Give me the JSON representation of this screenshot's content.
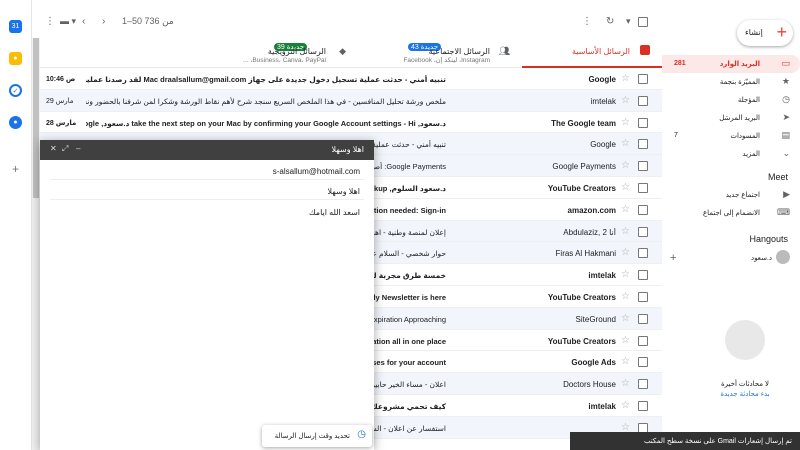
{
  "toolbar": {
    "pagination": "1–50 من 736"
  },
  "tabs": [
    {
      "name": "الرسائل الأساسية",
      "sub": "",
      "badge": ""
    },
    {
      "name": "الرسائل الاجتماعية",
      "sub": "Instagram، لينكد إن، Facebook",
      "badge": "43 جديدة"
    },
    {
      "name": "الرسائل الترويجية",
      "sub": "Business، Canva، PayPal، ...",
      "badge": "39 جديدة"
    }
  ],
  "emails": [
    {
      "sender": "Google",
      "subject": "تنبيه أمني - حدثت عملية تسجيل دخول جديدة على جهاز Mac draalsallum@gmail.com لقد رصدنا عملية تسجيل دخول جديدة إلى حسابك على Google",
      "date": "10:46 ص",
      "unread": true
    },
    {
      "sender": "imtelak",
      "subject": "ملخص ورشة تحليل المنافسين - في هذا الملخص السريع سنجد شرح لأهم نقاط الورشة وشكرا لمن شرفنا بالحضور ونسعد بكم دائما ورشة كله مساعدة وتشارك معنا",
      "date": "29 مارس",
      "unread": false
    },
    {
      "sender": "The Google team",
      "subject": "د.سعود, take the next step on your Mac by confirming your Google Account settings - Hi د.سعود, Welcome to Google",
      "date": "28 مارس",
      "unread": true
    },
    {
      "sender": "Google",
      "subject": "تنبيه أمني - حدثت عملية تسجيل دخول جديدة على جهاز",
      "date": "",
      "unread": false
    },
    {
      "sender": "Google Payments",
      "subject": "Google Payments: أصبحت مستندات تقارير",
      "date": "",
      "unread": false
    },
    {
      "sender": "YouTube Creators",
      "subject": "د.سعود السلوم, time for a security checkup",
      "date": "",
      "unread": true
    },
    {
      "sender": "amazon.com",
      "subject": "amazon.com, action needed: Sign-in",
      "date": "",
      "unread": true
    },
    {
      "sender": "Abdulaziz, أنا 2",
      "subject": "إعلان لمنصة وطنية - اهلاً وسهلاً سعر الاعلان على",
      "date": "",
      "unread": false
    },
    {
      "sender": "Firas Al Hakmani",
      "subject": "حوار شخصي - السلام عليكم ورحمة الله وبركاته",
      "date": "",
      "unread": false
    },
    {
      "sender": "imtelak",
      "subject": "خمسة طرق مجربة لزيادة ومضاعفة المبيعات وكتابة نص",
      "date": "",
      "unread": true
    },
    {
      "sender": "YouTube Creators",
      "subject": "Your Creator Monthly Newsletter is here!",
      "date": "",
      "unread": true
    },
    {
      "sender": "SiteGround",
      "subject": "Payment Method Expiration Approaching",
      "date": "",
      "unread": false
    },
    {
      "sender": "YouTube Creators",
      "subject": "New content + inspiration all in one place",
      "date": "",
      "unread": true
    },
    {
      "sender": "Google Ads",
      "subject": "Update arbitration clauses for your account",
      "date": "",
      "unread": true
    },
    {
      "sender": "Doctors House",
      "subject": "اعلان - مساء الخير حابين اعلان عن متجرنا متخصص",
      "date": "",
      "unread": false
    },
    {
      "sender": "imtelak",
      "subject": "كيف تحمي مشروعك من السقوط في وادي الموت!؟",
      "date": "",
      "unread": true
    },
    {
      "sender": "",
      "subject": "استفسار عن اعلان - السلام عليكم ورحمة الله وبركاته",
      "date": "",
      "unread": false
    }
  ],
  "sidebar": {
    "compose": "إنشاء",
    "nav": [
      {
        "label": "البريد الوارد",
        "count": "281",
        "icon": "inbox-icon",
        "glyph": "▭",
        "active": true
      },
      {
        "label": "المميّزة بنجمة",
        "count": "",
        "icon": "star-icon",
        "glyph": "★",
        "active": false
      },
      {
        "label": "المؤجلة",
        "count": "",
        "icon": "clock-icon",
        "glyph": "◷",
        "active": false
      },
      {
        "label": "البريد المرسَل",
        "count": "",
        "icon": "send-icon",
        "glyph": "➤",
        "active": false
      },
      {
        "label": "المسودات",
        "count": "7",
        "icon": "draft-icon",
        "glyph": "▤",
        "active": false
      },
      {
        "label": "المزيد",
        "count": "",
        "icon": "chevron-down-icon",
        "glyph": "⌄",
        "active": false
      }
    ],
    "meet_title": "Meet",
    "meet_items": [
      {
        "label": "اجتماع جديد",
        "icon": "video-icon",
        "glyph": "▶"
      },
      {
        "label": "الانضمام إلى اجتماع",
        "icon": "keyboard-icon",
        "glyph": "⌨"
      }
    ],
    "hangouts_title": "Hangouts",
    "hangouts_user": "د.سعود",
    "hangouts_empty": "لا محادثات أخيرة",
    "hangouts_start": "بدء محادثة جديدة"
  },
  "compose_dialog": {
    "title": "اهلا وسهلا",
    "to": "s-alsallum@hotmail.com",
    "subject": "اهلا وسهلا",
    "body": "اسعد الله ايامك",
    "schedule_label": "تحديد وقت إرسال الرسالة"
  },
  "toast": "تم إرسال إشعارات Gmail على نسخة سطح المكتب"
}
